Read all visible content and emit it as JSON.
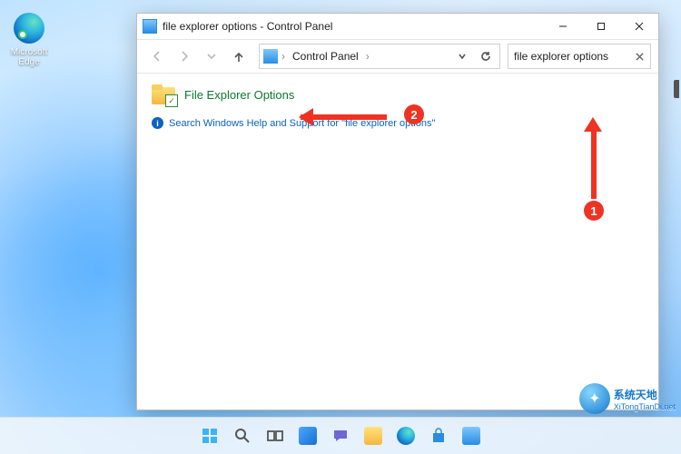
{
  "desktop": {
    "edge_label": "Microsoft\nEdge"
  },
  "window": {
    "title": "file explorer options - Control Panel",
    "breadcrumb": {
      "root": "Control Panel"
    },
    "search": {
      "value": "file explorer options"
    },
    "result_label": "File Explorer Options",
    "help_text": "Search Windows Help and Support for \"file explorer options\""
  },
  "annotations": {
    "step1": "1",
    "step2": "2"
  },
  "watermark": {
    "cn": "系统天地",
    "en": "XiTongTianDi.net"
  },
  "colors": {
    "accent_green": "#0a7a2f",
    "link_blue": "#0b62c2",
    "annotation_red": "#e32"
  }
}
